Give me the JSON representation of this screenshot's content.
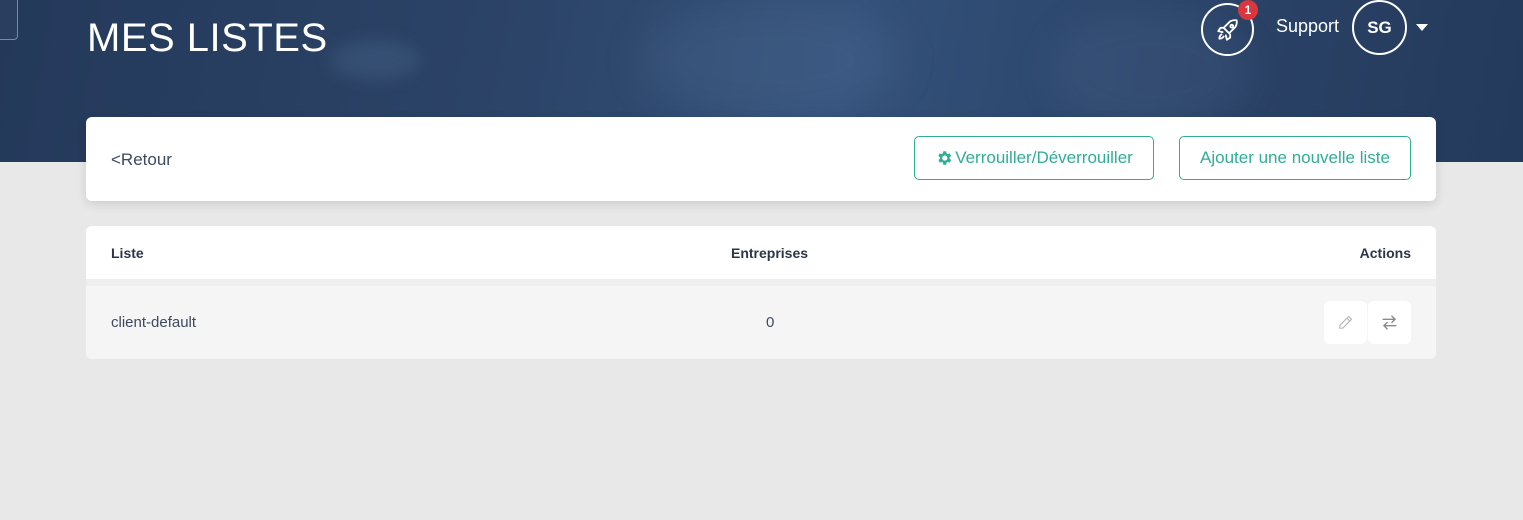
{
  "header": {
    "title": "MES LISTES",
    "notification_count": "1",
    "notification_icon": "rocket-icon",
    "support_label": "Support",
    "avatar_initials": "SG",
    "colors": {
      "hero": "#2c4468",
      "badge": "#d9363e"
    }
  },
  "toolbar": {
    "back_label": "<Retour",
    "lock_label": "Verrouiller/Déverrouiller",
    "lock_icon": "gear-icon",
    "add_label": "Ajouter une nouvelle liste",
    "accent_color": "#2eae94"
  },
  "table": {
    "columns": [
      "Liste",
      "Entreprises",
      "Actions"
    ],
    "rows": [
      {
        "name": "client-default",
        "companies": "0",
        "actions": [
          "pencil-icon",
          "transfer-icon"
        ]
      }
    ]
  }
}
